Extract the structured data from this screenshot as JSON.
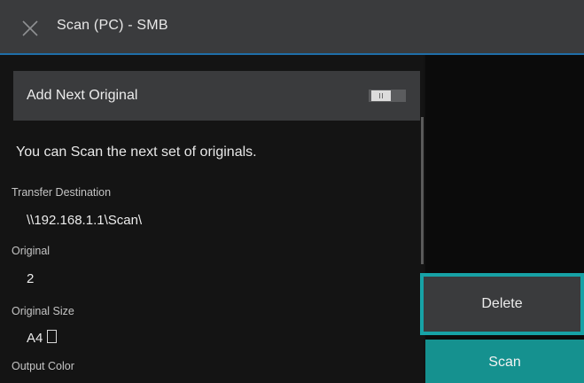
{
  "header": {
    "title": "Scan (PC) - SMB",
    "close_icon": "close-icon"
  },
  "add_next": {
    "label": "Add Next Original",
    "toggle_state": "off"
  },
  "message": "You can Scan the next set of originals.",
  "fields": {
    "transfer_destination": {
      "label": "Transfer Destination",
      "value": "\\\\192.168.1.1\\Scan\\"
    },
    "original": {
      "label": "Original",
      "value": "2"
    },
    "original_size": {
      "label": "Original Size",
      "value": "A4",
      "orientation_icon": "portrait-paper-icon"
    },
    "output_color": {
      "label": "Output Color"
    }
  },
  "actions": {
    "delete_label": "Delete",
    "scan_label": "Scan"
  },
  "colors": {
    "accent_blue": "#1f6ea8",
    "teal": "#15918f",
    "teal_border": "#17a2a6",
    "panel": "#3a3b3d"
  }
}
